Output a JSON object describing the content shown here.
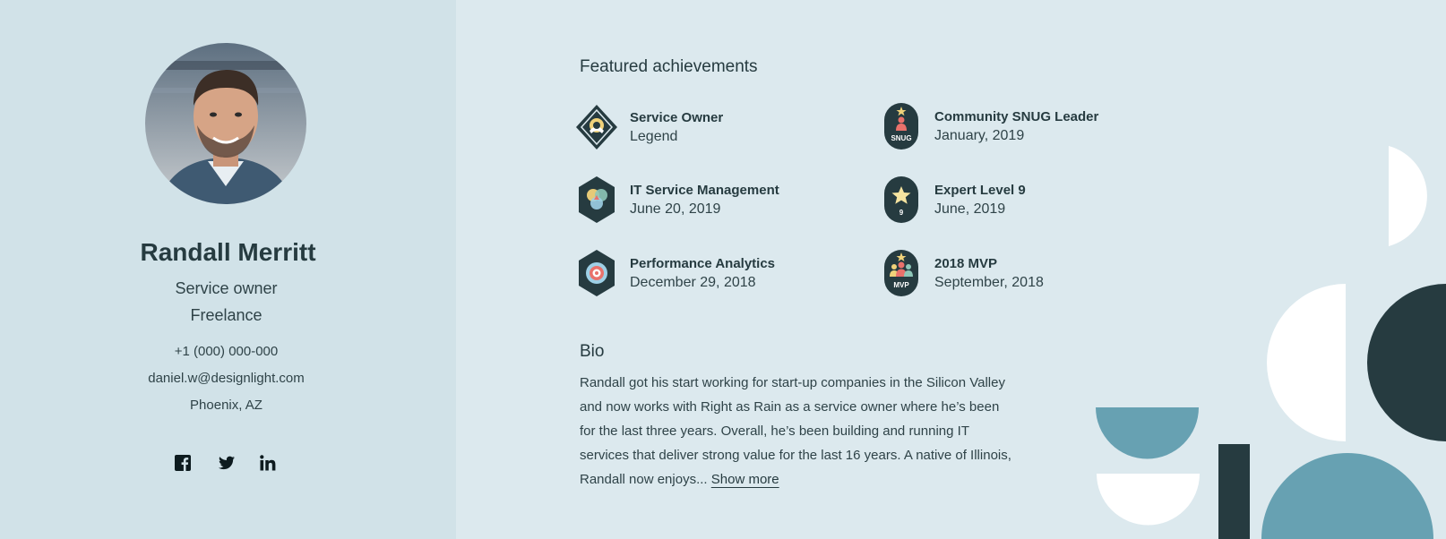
{
  "profile": {
    "name": "Randall Merritt",
    "role": "Service owner",
    "company": "Freelance",
    "phone": "+1 (000) 000-000",
    "email": "daniel.w@designlight.com",
    "location": "Phoenix, AZ"
  },
  "social": [
    {
      "icon": "facebook-icon"
    },
    {
      "icon": "twitter-icon"
    },
    {
      "icon": "linkedin-icon"
    }
  ],
  "achievements_title": "Featured achievements",
  "achievements": [
    {
      "title": "Service Owner",
      "subtitle": "Legend",
      "icon": "service-owner-badge-icon"
    },
    {
      "title": "Community SNUG Leader",
      "subtitle": "January, 2019",
      "icon": "snug-badge-icon",
      "badge_text": "SNUG"
    },
    {
      "title": "IT Service Management",
      "subtitle": "June 20, 2019",
      "icon": "itsm-badge-icon"
    },
    {
      "title": "Expert Level 9",
      "subtitle": "June, 2019",
      "icon": "expert-level-badge-icon",
      "badge_text": "9"
    },
    {
      "title": "Performance Analytics",
      "subtitle": "December 29, 2018",
      "icon": "performance-analytics-badge-icon"
    },
    {
      "title": "2018 MVP",
      "subtitle": "September, 2018",
      "icon": "mvp-badge-icon",
      "badge_text": "MVP"
    }
  ],
  "bio_title": "Bio",
  "bio_text": "Randall got his start working for start-up companies in the Silicon Valley and now works with Right as Rain as a service owner where he’s been for the last three years. Overall, he’s been building and running IT services that deliver strong value for the last 16 years. A native of Illinois, Randall now enjoys...",
  "show_more": "Show more",
  "colors": {
    "left_panel": "#d1e2e8",
    "main_bg": "#dce9ee",
    "dark": "#263b40",
    "teal": "#67a1b2",
    "white": "#ffffff"
  }
}
